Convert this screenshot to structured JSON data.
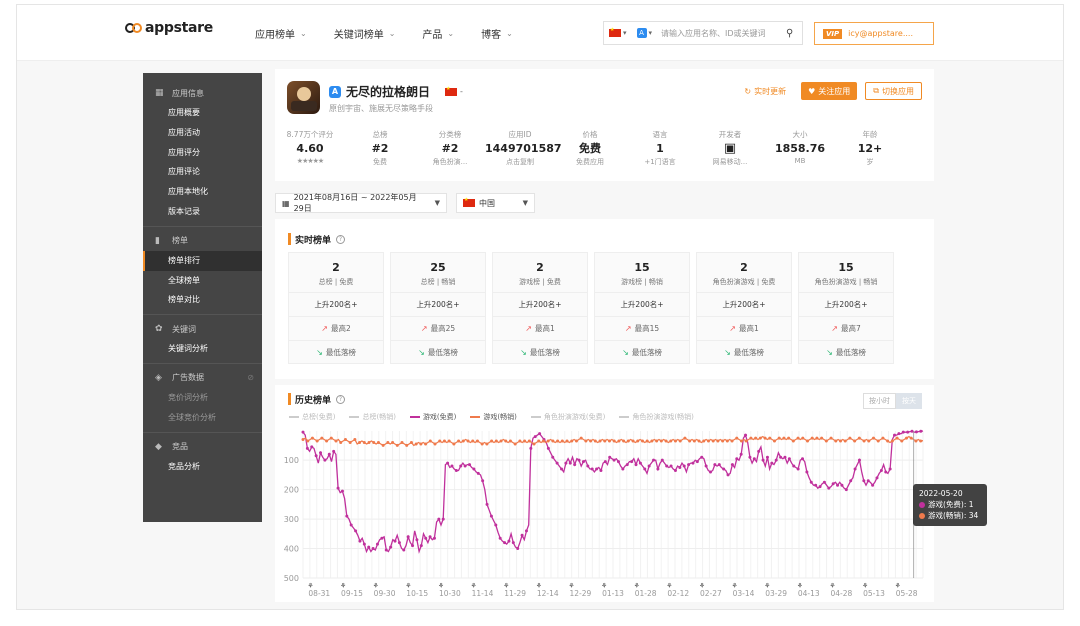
{
  "brand": "appstare",
  "nav": [
    {
      "label": "应用榜单"
    },
    {
      "label": "关键词榜单"
    },
    {
      "label": "产品"
    },
    {
      "label": "博客"
    }
  ],
  "search": {
    "placeholder": "请输入应用名称、ID或关键词"
  },
  "user": {
    "vip": "VIP",
    "email": "icy@appstare...."
  },
  "sidebar": {
    "sections": [
      {
        "label": "应用信息",
        "icon": "grid-icon",
        "items": [
          {
            "label": "应用概要"
          },
          {
            "label": "应用活动"
          },
          {
            "label": "应用评分"
          },
          {
            "label": "应用评论"
          },
          {
            "label": "应用本地化"
          },
          {
            "label": "版本记录"
          }
        ]
      },
      {
        "label": "榜单",
        "icon": "bar-chart-icon",
        "items": [
          {
            "label": "榜单排行",
            "active": true
          },
          {
            "label": "全球榜单"
          },
          {
            "label": "榜单对比"
          }
        ]
      },
      {
        "label": "关键词",
        "icon": "keyword-icon",
        "items": [
          {
            "label": "关键词分析"
          }
        ]
      },
      {
        "label": "广告数据",
        "icon": "ad-icon",
        "items": [
          {
            "label": "竞价词分析",
            "dim": true
          },
          {
            "label": "全球竞价分析",
            "dim": true
          }
        ]
      },
      {
        "label": "竞品",
        "icon": "competitor-icon",
        "items": [
          {
            "label": "竞品分析"
          }
        ]
      }
    ]
  },
  "app": {
    "name": "无尽的拉格朗日",
    "subtitle": "原创宇宙、施展无尽策略手段",
    "country_caret": "-",
    "buttons": {
      "refresh": "实时更新",
      "follow": "关注应用",
      "switch": "切换应用"
    },
    "stats": [
      {
        "label": "8.77万个评分",
        "value": "4.60",
        "sub": "★★★★★"
      },
      {
        "label": "总榜",
        "value": "#2",
        "sub": "免费"
      },
      {
        "label": "分类榜",
        "value": "#2",
        "sub": "角色扮演..."
      },
      {
        "label": "应用ID",
        "value": "1449701587",
        "sub": "点击复制"
      },
      {
        "label": "价格",
        "value": "免费",
        "sub": "免费应用"
      },
      {
        "label": "语言",
        "value": "1",
        "sub": "+1门语言"
      },
      {
        "label": "开发者",
        "value": "",
        "sub": "网易移动..."
      },
      {
        "label": "大小",
        "value": "1858.76",
        "sub": "MB"
      },
      {
        "label": "年龄",
        "value": "12+",
        "sub": "岁"
      }
    ]
  },
  "filters": {
    "date_range": "2021年08月16日 ~ 2022年05月29日",
    "country": "中国"
  },
  "realtime": {
    "title": "实时榜单",
    "tiles": [
      {
        "rank": "2",
        "cat": "总榜 | 免费",
        "rise": "上升200名+",
        "best": "最高2",
        "low": "最低落榜"
      },
      {
        "rank": "25",
        "cat": "总榜 | 畅销",
        "rise": "上升200名+",
        "best": "最高25",
        "low": "最低落榜"
      },
      {
        "rank": "2",
        "cat": "游戏榜 | 免费",
        "rise": "上升200名+",
        "best": "最高1",
        "low": "最低落榜"
      },
      {
        "rank": "15",
        "cat": "游戏榜 | 畅销",
        "rise": "上升200名+",
        "best": "最高15",
        "low": "最低落榜"
      },
      {
        "rank": "2",
        "cat": "角色扮演游戏 | 免费",
        "rise": "上升200名+",
        "best": "最高1",
        "low": "最低落榜"
      },
      {
        "rank": "15",
        "cat": "角色扮演游戏 | 畅销",
        "rise": "上升200名+",
        "best": "最高7",
        "low": "最低落榜"
      }
    ]
  },
  "history": {
    "title": "历史榜单",
    "toggle": [
      "按小时",
      "按天"
    ],
    "legend": [
      {
        "label": "总榜(免费)",
        "color": "#cccccc",
        "on": false
      },
      {
        "label": "总榜(畅销)",
        "color": "#cccccc",
        "on": false
      },
      {
        "label": "游戏(免费)",
        "color": "#c0309c",
        "on": true
      },
      {
        "label": "游戏(畅销)",
        "color": "#ef7a4c",
        "on": true
      },
      {
        "label": "角色扮演游戏(免费)",
        "color": "#cccccc",
        "on": false
      },
      {
        "label": "角色扮演游戏(畅销)",
        "color": "#cccccc",
        "on": false
      }
    ],
    "tooltip": {
      "date": "2022-05-20",
      "line1": "游戏(免费): 1",
      "line2": "游戏(畅销): 34"
    }
  },
  "chart_data": {
    "type": "line",
    "y_inverted": true,
    "ylim": [
      500,
      1
    ],
    "yticks": [
      "100",
      "200",
      "300",
      "400",
      "500"
    ],
    "xticks": [
      "08-31",
      "09-15",
      "09-30",
      "10-15",
      "10-30",
      "11-14",
      "11-29",
      "12-14",
      "12-29",
      "01-13",
      "01-28",
      "02-12",
      "02-27",
      "03-14",
      "03-29",
      "04-13",
      "04-28",
      "05-13",
      "05-28"
    ],
    "series": [
      {
        "name": "游戏(免费)",
        "color": "#c0309c",
        "values": [
          5,
          15,
          60,
          70,
          55,
          60,
          85,
          110,
          75,
          90,
          100,
          95,
          80,
          105,
          70,
          80,
          195,
          210,
          205,
          230,
          290,
          300,
          320,
          330,
          340,
          355,
          375,
          365,
          385,
          410,
          395,
          410,
          400,
          405,
          385,
          370,
          365,
          360,
          405,
          410,
          395,
          370,
          375,
          355,
          380,
          400,
          405,
          390,
          360,
          380,
          390,
          340,
          370,
          410,
          390,
          350,
          365,
          380,
          360,
          370,
          365,
          310,
          300,
          320,
          300,
          115,
          110,
          125,
          120,
          130,
          135,
          135,
          120,
          110,
          120,
          115,
          115,
          125,
          130,
          140,
          145,
          150,
          170,
          200,
          250,
          270,
          290,
          305,
          320,
          345,
          365,
          375,
          380,
          385,
          375,
          350,
          380,
          395,
          400,
          380,
          355,
          370,
          340,
          320,
          60,
          25,
          20,
          15,
          10,
          20,
          30,
          40,
          60,
          75,
          90,
          100,
          110,
          120,
          130,
          140,
          110,
          95,
          110,
          90,
          115,
          95,
          100,
          120,
          105,
          100,
          120,
          130,
          130,
          140,
          130,
          125,
          135,
          110,
          105,
          115,
          90,
          95,
          100,
          95,
          105,
          120,
          130,
          120,
          115,
          105,
          105,
          95,
          115,
          95,
          110,
          120,
          130,
          145,
          120,
          110,
          100,
          100,
          130,
          110,
          100,
          110,
          120,
          125,
          120,
          130,
          135,
          120,
          125,
          110,
          120,
          140,
          115,
          110,
          110,
          100,
          105,
          95,
          90,
          95,
          120,
          135,
          140,
          135,
          115,
          120,
          115,
          125,
          130,
          135,
          150,
          145,
          115,
          125,
          95,
          100,
          80,
          25,
          15,
          40,
          90,
          110,
          95,
          105,
          70,
          55,
          100,
          120,
          90,
          130,
          110,
          115,
          100,
          75,
          90,
          95,
          90,
          110,
          95,
          110,
          120,
          125,
          130,
          100,
          95,
          105,
          140,
          160,
          175,
          185,
          185,
          195,
          190,
          180,
          175,
          185,
          195,
          190,
          180,
          175,
          185,
          175,
          185,
          195,
          200,
          185,
          170,
          160,
          130,
          115,
          100,
          140,
          170,
          185,
          170,
          175,
          185,
          175,
          160,
          145,
          135,
          115,
          140,
          145,
          130,
          30,
          15,
          15,
          10,
          10,
          5,
          5,
          5,
          3,
          2,
          5,
          4,
          3,
          2,
          1
        ]
      },
      {
        "name": "游戏(畅销)",
        "color": "#ef7a4c",
        "values": [
          30,
          25,
          35,
          30,
          25,
          30,
          35,
          30,
          25,
          30,
          35,
          30,
          25,
          30,
          35,
          30,
          40,
          35,
          30,
          35,
          40,
          35,
          30,
          45,
          40,
          35,
          40,
          45,
          40,
          35,
          40,
          45,
          40,
          45,
          50,
          45,
          40,
          45,
          40,
          45,
          50,
          45,
          40,
          45,
          50,
          45,
          40,
          50,
          45,
          40,
          45,
          40,
          45,
          40,
          35,
          40,
          45,
          40,
          35,
          40,
          35,
          40,
          35,
          40,
          45,
          40,
          35,
          40,
          35,
          30,
          35,
          40,
          35,
          40,
          35,
          40,
          45,
          40,
          45,
          40,
          35,
          40,
          35,
          40,
          35,
          30,
          35,
          40,
          35,
          40,
          45,
          40,
          35,
          40,
          35,
          40,
          35,
          40,
          45,
          40,
          35,
          40,
          35,
          40,
          35,
          30,
          35,
          40,
          35,
          40,
          35,
          40,
          35,
          40,
          35,
          30,
          35,
          30,
          25,
          30,
          35,
          30,
          35,
          30,
          35,
          40,
          35,
          30,
          35,
          30,
          35,
          30,
          35,
          40,
          35,
          30,
          35,
          40,
          35,
          30,
          35,
          40,
          35,
          30,
          35,
          40,
          35,
          40,
          35,
          30,
          35,
          30,
          35,
          30,
          35,
          40,
          35,
          30,
          35,
          30,
          35,
          30,
          25,
          30,
          35,
          30,
          35,
          30,
          35,
          40,
          35,
          30,
          35,
          30,
          35,
          30,
          35,
          30,
          35,
          30,
          35,
          30,
          35,
          30,
          25,
          30,
          35,
          30,
          35,
          30,
          25,
          30,
          25,
          30,
          25,
          20,
          25,
          30,
          25,
          30,
          35,
          30,
          25,
          30,
          25,
          30,
          25,
          30,
          35,
          30,
          25,
          30,
          25,
          30,
          35,
          30,
          25,
          30,
          25,
          30,
          25,
          30,
          35,
          30,
          25,
          30,
          35,
          30,
          35,
          30,
          35,
          30,
          25,
          30,
          35,
          30,
          25,
          30,
          35,
          30,
          35,
          30,
          25,
          30,
          35,
          30,
          25,
          30,
          35,
          40,
          35,
          30,
          25,
          30,
          35,
          30,
          25,
          20,
          25,
          30,
          35,
          30,
          35,
          34
        ]
      }
    ]
  }
}
